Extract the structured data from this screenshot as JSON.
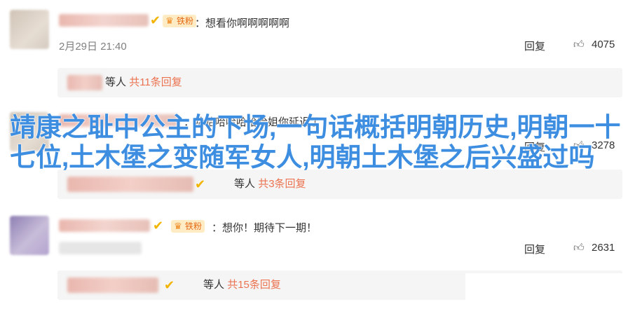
{
  "comments": [
    {
      "badge": "铁粉",
      "text": "：想看你啊啊啊啊啊",
      "time": "2月29日 21:40",
      "reply": "回复",
      "likes": "4075",
      "replies_prefix": "等人",
      "replies_count": "共11条回复"
    },
    {
      "text": "：哈哈哈哈哈哈哈姐你延迟了",
      "reply": "回复",
      "likes": "3278",
      "replies_prefix": "等人",
      "replies_count": "共3条回复"
    },
    {
      "badge": "铁粉",
      "text": "：想你！期待下一期！",
      "reply": "回复",
      "likes": "2631",
      "replies_prefix": "等人",
      "replies_count": "共15条回复"
    }
  ],
  "overlay_title": "靖康之耻中公主的下场,一句话概括明朝历史,明朝一十七位,土木堡之变随军女人,明朝土木堡之后兴盛过吗"
}
